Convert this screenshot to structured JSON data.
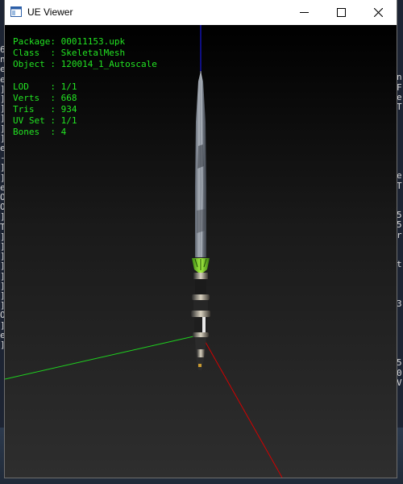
{
  "window": {
    "title": "UE Viewer"
  },
  "info": {
    "package_label": "Package: ",
    "package": "00011153.upk",
    "class_label": "Class  : ",
    "class": "SkeletalMesh",
    "object_label": "Object : ",
    "object": "120014_1_Autoscale",
    "lod_label": "LOD    : ",
    "lod": "1/1",
    "verts_label": "Verts  : ",
    "verts": "668",
    "tris_label": "Tris   : ",
    "tris": "934",
    "uvset_label": "UV Set : ",
    "uvset": "1/1",
    "bones_label": "Bones  : ",
    "bones": "4"
  },
  "console_left": "6\nn\ne\ne\n]\n]\n]\n]\n]\n]\ne\n-\n]\n]\ne\nO\nO\n]\nT\n]\n]\n]\n]\n]\n]\n]\n]\nO\n]\ne\n]",
  "console_right": "\n\nn\nF\ne\nT\n\n\n\n\n\n\ne\nT\n\n\n5\n5\nr\n\n\nt\n\n\n\n3\n\n\n\n\n\n5\n0\nV",
  "colors": {
    "text_green": "#22e422",
    "axis_x": "#d40000",
    "axis_y": "#1fd21f",
    "axis_z": "#1a1aff"
  }
}
